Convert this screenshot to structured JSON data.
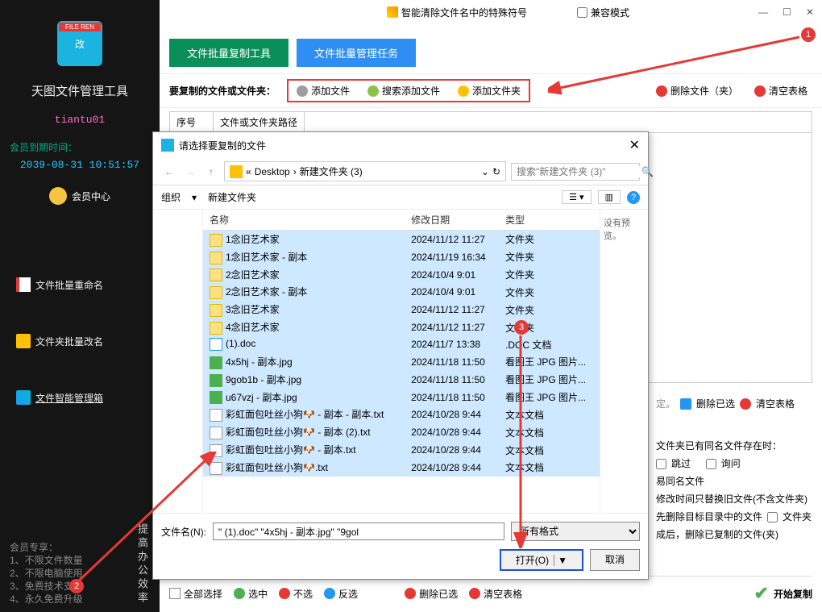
{
  "titlebar": {
    "feature_text": "智能清除文件名中的特殊符号",
    "compat_text": "兼容模式"
  },
  "sidebar": {
    "logo_tag": "FILE REN",
    "logo_char": "改",
    "app_title": "天图文件管理工具",
    "username": "tiantu01",
    "expire_label": "会员到期时间：",
    "expire_date": "2039-08-31 10:51:57",
    "vip_center": "会员中心",
    "nav": [
      {
        "label": "文件批量重命名"
      },
      {
        "label": "文件夹批量改名"
      },
      {
        "label": "文件智能管理箱"
      }
    ],
    "footer_title": "会员专享：",
    "footer_lines": [
      "1、不限文件数量",
      "2、不限电脑使用",
      "3、免费技术支持",
      "4、永久免费升级"
    ],
    "vtext": "提高办公效率"
  },
  "main": {
    "tab_copy": "文件批量复制工具",
    "tab_task": "文件批量管理任务",
    "toolbar_label": "要复制的文件或文件夹：",
    "btn_add_file": "添加文件",
    "btn_search_add": "搜索添加文件",
    "btn_add_folder": "添加文件夹",
    "btn_delete": "删除文件（夹）",
    "btn_clear": "清空表格",
    "col_seq": "序号",
    "col_path": "文件或文件夹路径"
  },
  "rightopts": {
    "del_sel": "删除已选",
    "clear": "清空表格",
    "same_label": "文件夹已有同名文件存在时：",
    "skip": "跳过",
    "ask": "询问",
    "line1": "易同名文件",
    "line2": "修改时间只替换旧文件(不含文件夹)",
    "line3": "先删除目标目录中的文件",
    "line3b": "文件夹",
    "line4": "成后，删除已复制的文件(夹)"
  },
  "bottombar": {
    "select_all": "全部选择",
    "sel_yes": "选中",
    "sel_no": "不选",
    "reverse": "反选",
    "del_sel": "删除已选",
    "clear": "清空表格",
    "start": "开始复制"
  },
  "dialog": {
    "title": "请选择要复制的文件",
    "path_prefix": "«",
    "path_seg1": "Desktop",
    "path_seg2": "新建文件夹 (3)",
    "search_placeholder": "搜索\"新建文件夹 (3)\"",
    "organize": "组织",
    "new_folder": "新建文件夹",
    "no_preview": "没有预览。",
    "col_name": "名称",
    "col_date": "修改日期",
    "col_type": "类型",
    "filename_label": "文件名(N):",
    "filename_value": "\" (1).doc\" \"4x5hj - 副本.jpg\" \"9gol",
    "filter": "所有格式",
    "open": "打开(O)",
    "cancel": "取消",
    "files": [
      {
        "icon": "folder",
        "name": "1念旧艺术家",
        "date": "2024/11/12 11:27",
        "type": "文件夹"
      },
      {
        "icon": "folder",
        "name": "1念旧艺术家 - 副本",
        "date": "2024/11/19 16:34",
        "type": "文件夹"
      },
      {
        "icon": "folder",
        "name": "2念旧艺术家",
        "date": "2024/10/4 9:01",
        "type": "文件夹"
      },
      {
        "icon": "folder",
        "name": "2念旧艺术家 - 副本",
        "date": "2024/10/4 9:01",
        "type": "文件夹"
      },
      {
        "icon": "folder",
        "name": "3念旧艺术家",
        "date": "2024/11/12 11:27",
        "type": "文件夹"
      },
      {
        "icon": "folder",
        "name": "4念旧艺术家",
        "date": "2024/11/12 11:27",
        "type": "文件夹"
      },
      {
        "icon": "doc",
        "name": "(1).doc",
        "date": "2024/11/7 13:38",
        "type": ".DOC 文档"
      },
      {
        "icon": "img",
        "name": "4x5hj - 副本.jpg",
        "date": "2024/11/18 11:50",
        "type": "看图王 JPG 图片..."
      },
      {
        "icon": "img",
        "name": "9gob1b - 副本.jpg",
        "date": "2024/11/18 11:50",
        "type": "看图王 JPG 图片..."
      },
      {
        "icon": "img",
        "name": "u67vzj - 副本.jpg",
        "date": "2024/11/18 11:50",
        "type": "看图王 JPG 图片..."
      },
      {
        "icon": "txt",
        "name": "彩虹面包吐丝小狗🐶 - 副本 - 副本.txt",
        "date": "2024/10/28 9:44",
        "type": "文本文档"
      },
      {
        "icon": "txt",
        "name": "彩虹面包吐丝小狗🐶 - 副本 (2).txt",
        "date": "2024/10/28 9:44",
        "type": "文本文档"
      },
      {
        "icon": "txt",
        "name": "彩虹面包吐丝小狗🐶 - 副本.txt",
        "date": "2024/10/28 9:44",
        "type": "文本文档"
      },
      {
        "icon": "txt",
        "name": "彩虹面包吐丝小狗🐶.txt",
        "date": "2024/10/28 9:44",
        "type": "文本文档"
      }
    ]
  },
  "annotations": {
    "b1": "1",
    "b2": "2",
    "b3": "3"
  }
}
